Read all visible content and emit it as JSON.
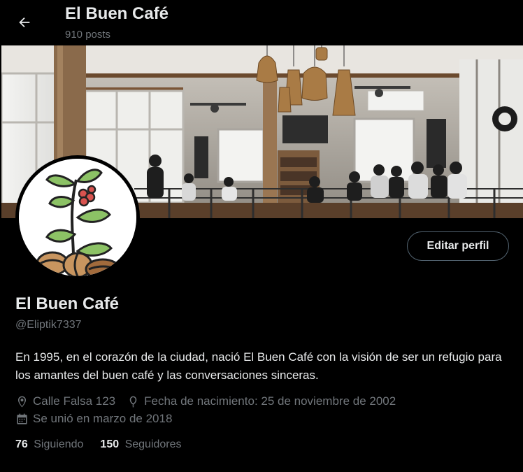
{
  "header": {
    "title": "El Buen Café",
    "posts_count": "910 posts"
  },
  "icons": {
    "back": "arrow-left-icon",
    "location": "location-pin-icon",
    "birthday": "balloon-icon",
    "joined": "calendar-icon"
  },
  "profile": {
    "name": "El Buen Café",
    "handle": "@Eliptik7337",
    "edit_label": "Editar perfil",
    "bio": "En 1995, en el corazón de la ciudad, nació El Buen Café con la visión de ser un refugio para los amantes del buen café y las conversaciones sinceras.",
    "location": "Calle Falsa 123",
    "birthday": "Fecha de nacimiento: 25 de noviembre de 2002",
    "joined": "Se unió en marzo de 2018",
    "following_count": "76",
    "following_label": "Siguiendo",
    "followers_count": "150",
    "followers_label": "Seguidores"
  },
  "colors": {
    "background": "#000000",
    "text_primary": "#e7e9ea",
    "text_secondary": "#71767b",
    "button_border": "#536471"
  }
}
